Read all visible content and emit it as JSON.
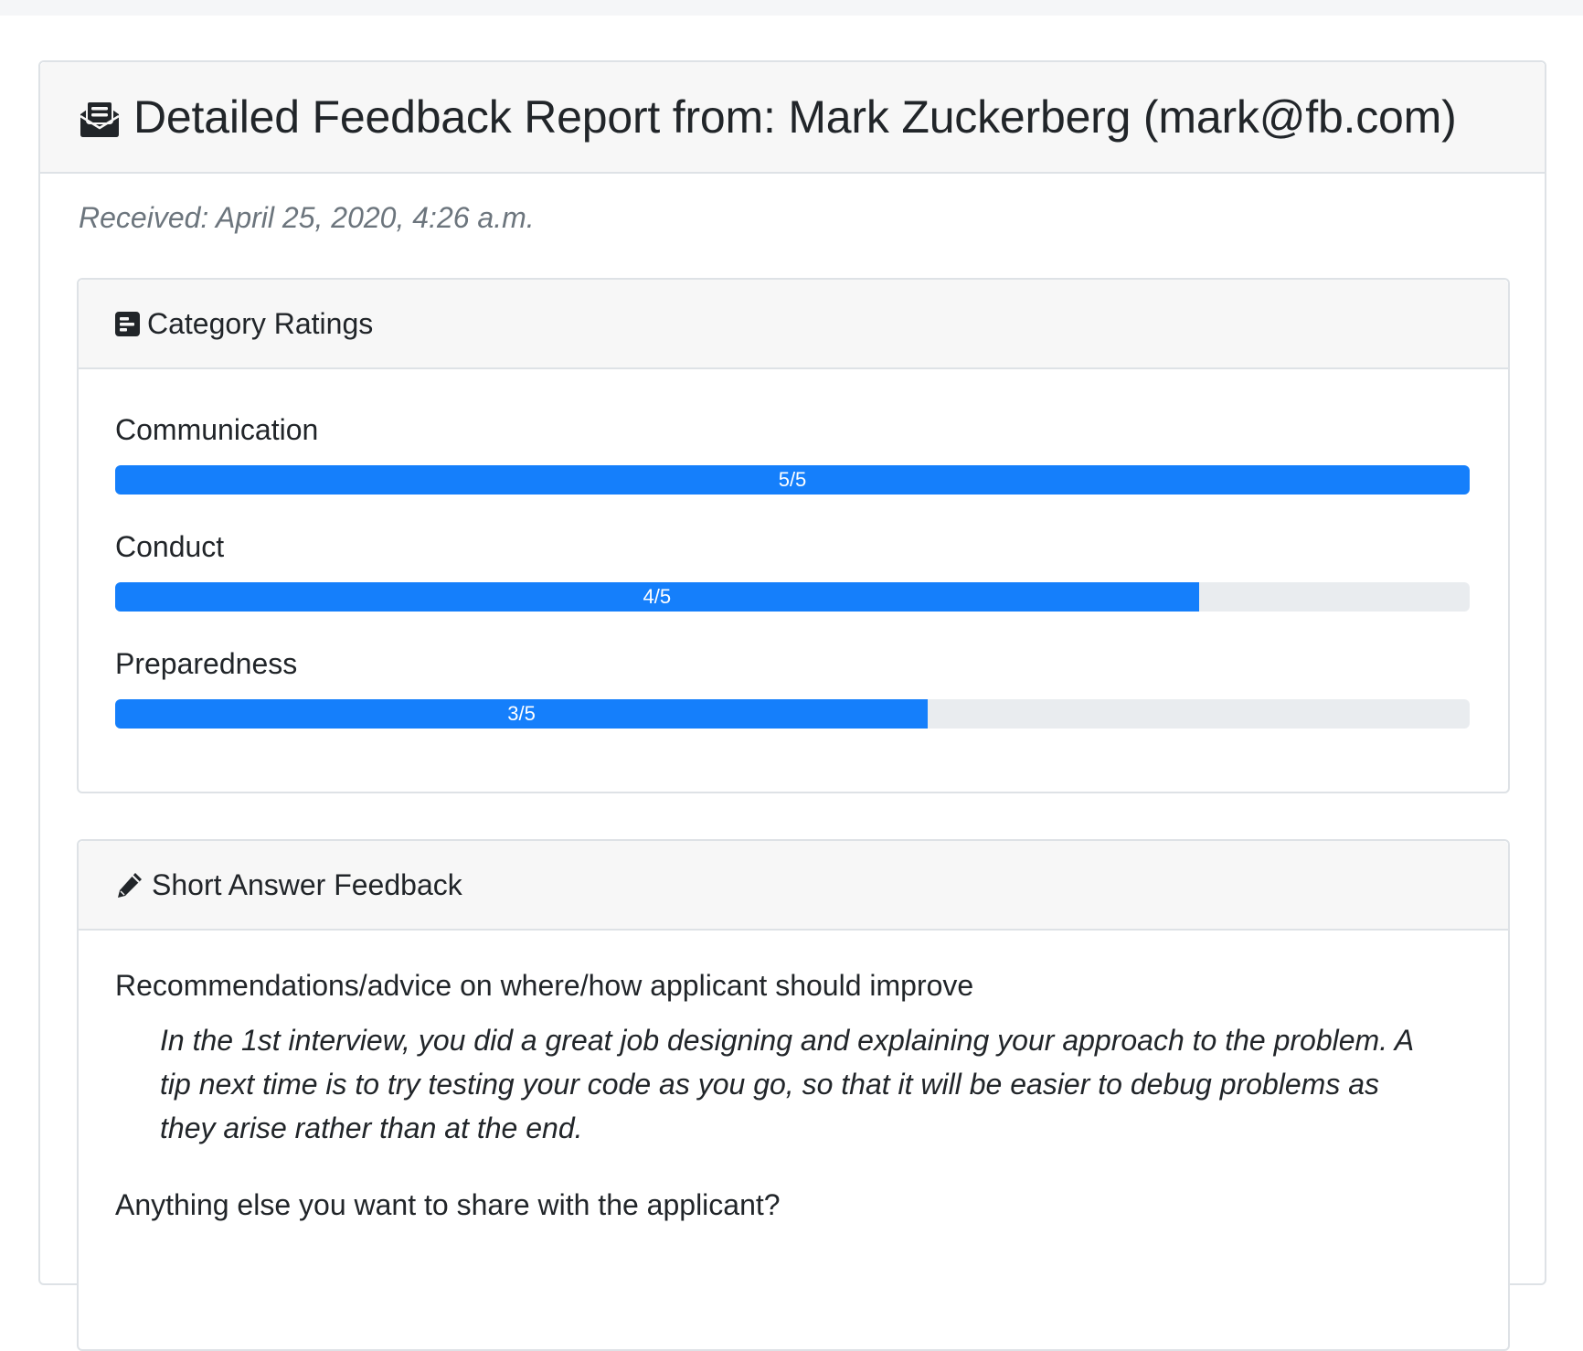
{
  "report": {
    "title": "Detailed Feedback Report from: Mark Zuckerberg (mark@fb.com)",
    "received": "Received: April 25, 2020, 4:26 a.m."
  },
  "ratings": {
    "header": "Category Ratings",
    "items": [
      {
        "label": "Communication",
        "value_text": "5/5",
        "value": 5,
        "max": 5
      },
      {
        "label": "Conduct",
        "value_text": "4/5",
        "value": 4,
        "max": 5
      },
      {
        "label": "Preparedness",
        "value_text": "3/5",
        "value": 3,
        "max": 5
      }
    ]
  },
  "short_answers": {
    "header": "Short Answer Feedback",
    "items": [
      {
        "question": "Recommendations/advice on where/how applicant should improve",
        "answer": "In the 1st interview, you did a great job designing and explaining your approach to the problem. A tip next time is to try testing your code as you go, so that it will be easier to debug problems as they arise rather than at the end."
      },
      {
        "question": "Anything else you want to share with the applicant?",
        "answer": ""
      }
    ]
  },
  "colors": {
    "progress_fill": "#157ffb",
    "progress_track": "#e9ecef",
    "card_header_bg": "#f7f7f7",
    "border": "#dee2e6",
    "muted_text": "#6c757d"
  },
  "icons": {
    "report_header": "envelope-open-text-icon",
    "ratings_header": "poll-h-icon",
    "short_answer_header": "pencil-icon"
  }
}
